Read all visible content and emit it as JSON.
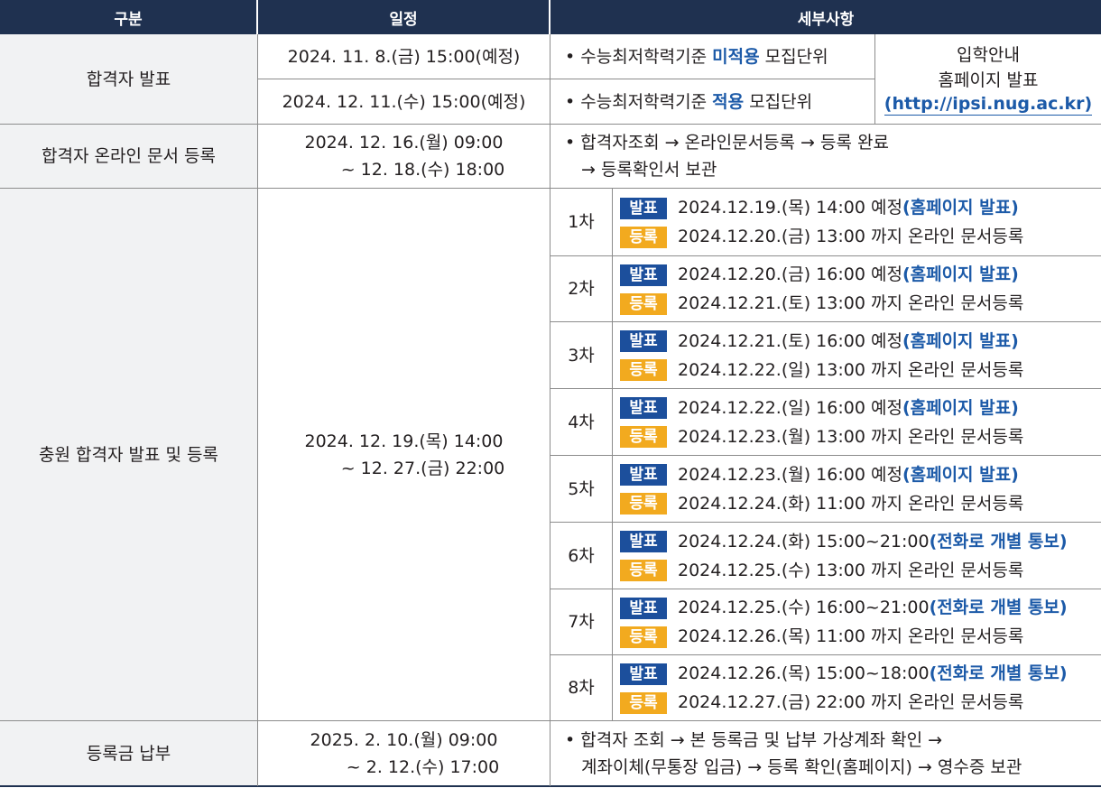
{
  "headers": {
    "category": "구분",
    "schedule": "일정",
    "details": "세부사항"
  },
  "announcement": {
    "label": "합격자 발표",
    "rows": [
      {
        "schedule": "2024. 11. 8.(금) 15:00(예정)",
        "pre": "• 수능최저학력기준 ",
        "strong": "미적용",
        "post": " 모집단위"
      },
      {
        "schedule": "2024. 12. 11.(수) 15:00(예정)",
        "pre": "• 수능최저학력기준 ",
        "strong": "적용",
        "post": " 모집단위"
      }
    ],
    "notice_line1": "입학안내",
    "notice_line2": "홈페이지 발표",
    "notice_url": "(http://ipsi.nug.ac.kr)"
  },
  "online_docs": {
    "label": "합격자 온라인 문서 등록",
    "schedule_line1": "2024. 12. 16.(월) 09:00",
    "schedule_line2": "~ 12. 18.(수) 18:00",
    "detail_line1": "• 합격자조회 → 온라인문서등록 → 등록 완료",
    "detail_line2": "→ 등록확인서 보관"
  },
  "additional": {
    "label": "충원 합격자 발표 및 등록",
    "schedule_line1": "2024. 12. 19.(목) 14:00",
    "schedule_line2": "~ 12. 27.(금) 22:00",
    "tag_publish": "발표",
    "tag_register": "등록",
    "rounds": [
      {
        "round": "1차",
        "pub": "2024.12.19.(목) 14:00 예정",
        "pub_note": "(홈페이지 발표)",
        "reg": "2024.12.20.(금) 13:00 까지 온라인 문서등록"
      },
      {
        "round": "2차",
        "pub": "2024.12.20.(금) 16:00 예정",
        "pub_note": "(홈페이지 발표)",
        "reg": "2024.12.21.(토) 13:00 까지 온라인 문서등록"
      },
      {
        "round": "3차",
        "pub": "2024.12.21.(토) 16:00 예정",
        "pub_note": "(홈페이지 발표)",
        "reg": "2024.12.22.(일) 13:00 까지 온라인 문서등록"
      },
      {
        "round": "4차",
        "pub": "2024.12.22.(일) 16:00 예정",
        "pub_note": "(홈페이지 발표)",
        "reg": "2024.12.23.(월) 13:00 까지 온라인 문서등록"
      },
      {
        "round": "5차",
        "pub": "2024.12.23.(월) 16:00 예정",
        "pub_note": "(홈페이지 발표)",
        "reg": "2024.12.24.(화) 11:00 까지 온라인 문서등록"
      },
      {
        "round": "6차",
        "pub": "2024.12.24.(화) 15:00~21:00",
        "pub_note": "(전화로 개별 통보)",
        "reg": "2024.12.25.(수) 13:00 까지 온라인 문서등록"
      },
      {
        "round": "7차",
        "pub": "2024.12.25.(수) 16:00~21:00",
        "pub_note": "(전화로 개별 통보)",
        "reg": "2024.12.26.(목) 11:00 까지 온라인 문서등록"
      },
      {
        "round": "8차",
        "pub": "2024.12.26.(목) 15:00~18:00",
        "pub_note": "(전화로 개별 통보)",
        "reg": "2024.12.27.(금) 22:00 까지 온라인 문서등록"
      }
    ]
  },
  "tuition": {
    "label": "등록금 납부",
    "schedule_line1": "2025. 2. 10.(월) 09:00",
    "schedule_line2": "~ 2. 12.(수) 17:00",
    "detail_line1": "• 합격자 조회 → 본 등록금 및 납부 가상계좌 확인 →",
    "detail_line2": "계좌이체(무통장 입금) → 등록 확인(홈페이지) → 영수증 보관"
  }
}
